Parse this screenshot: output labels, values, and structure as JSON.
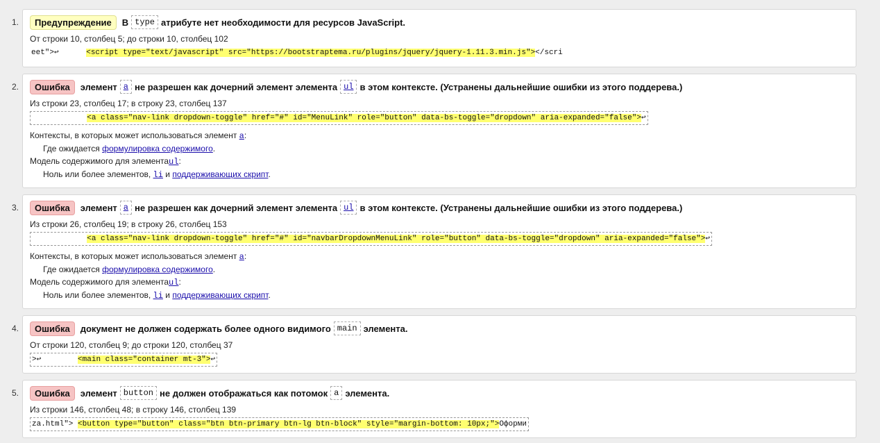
{
  "messages": [
    {
      "num": "1.",
      "badge": "Предупреждение",
      "t1": "В",
      "c1": "type",
      "t2": "атрибуте нет необходимости для ресурсов JavaScript.",
      "loc": "От строки 10, столбец 5; до строки 10, столбец 102",
      "pre": "eet\">↩      ",
      "hl": "<script type=\"text/javascript\" src=\"https://bootstraptema.ru/plugins/jquery/jquery-1.11.3.min.js\">",
      "post": "</scri"
    },
    {
      "num": "2.",
      "badge": "Ошибка",
      "t1": "элемент",
      "c1": "a",
      "t2": "не разрешен как дочерний элемент элемента",
      "c2": "ul",
      "t3": "в этом контексте. (Устранены дальнейшие ошибки из этого поддерева.)",
      "loc": "Из строки 23, столбец 17; в строку 23, столбец 137",
      "pre": "            ",
      "hl": "<a class=\"nav-link dropdown-toggle\" href=\"#\" id=\"MenuLink\" role=\"button\" data-bs-toggle=\"dropdown\" aria-expanded=\"false\">",
      "post": "↩",
      "ctx1_pre": "Контексты, в которых может использоваться элемент ",
      "ctx1_code": "a",
      "ctx1_post": ":",
      "ctx2_pre": "Где ожидается ",
      "ctx2_link": "формулировка содержимого",
      "ctx2_post": ".",
      "ctx3_pre": "Модель содержимого для элемента",
      "ctx3_code": "ul",
      "ctx3_post": ":",
      "ctx4_pre": "Ноль или более элементов, ",
      "ctx4_code": "li",
      "ctx4_mid": " и ",
      "ctx4_link": "поддерживающих скрипт",
      "ctx4_post": "."
    },
    {
      "num": "3.",
      "badge": "Ошибка",
      "t1": "элемент",
      "c1": "a",
      "t2": "не разрешен как дочерний элемент элемента",
      "c2": "ul",
      "t3": "в этом контексте. (Устранены дальнейшие ошибки из этого поддерева.)",
      "loc": "Из строки 26, столбец 19; в строку 26, столбец 153",
      "pre": "            ",
      "hl": "<a class=\"nav-link dropdown-toggle\" href=\"#\" id=\"navbarDropdownMenuLink\" role=\"button\" data-bs-toggle=\"dropdown\" aria-expanded=\"false\">",
      "post": "↩",
      "ctx1_pre": "Контексты, в которых может использоваться элемент ",
      "ctx1_code": "a",
      "ctx1_post": ":",
      "ctx2_pre": "Где ожидается ",
      "ctx2_link": "формулировка содержимого",
      "ctx2_post": ".",
      "ctx3_pre": "Модель содержимого для элемента",
      "ctx3_code": "ul",
      "ctx3_post": ":",
      "ctx4_pre": "Ноль или более элементов, ",
      "ctx4_code": "li",
      "ctx4_mid": " и ",
      "ctx4_link": "поддерживающих скрипт",
      "ctx4_post": "."
    },
    {
      "num": "4.",
      "badge": "Ошибка",
      "t1": "документ не должен содержать более одного видимого",
      "c1": "main",
      "t2": "элемента.",
      "loc": "От строки 120, столбец 9; до строки 120, столбец 37",
      "pre": ">↩        ",
      "hl": "<main class=\"container mt-3\">",
      "post": "↩"
    },
    {
      "num": "5.",
      "badge": "Ошибка",
      "t1": "элемент",
      "c1": "button",
      "t2": "не должен отображаться как потомок",
      "c2": "a",
      "t3": "элемента.",
      "loc": "Из строки 146, столбец 48; в строку 146, столбец 139",
      "pre": "za.html\"> ",
      "hl": "<button type=\"button\" class=\"btn btn-primary btn-lg btn-block\" style=\"margin-bottom: 10px;\">",
      "post": "Оформи"
    }
  ]
}
